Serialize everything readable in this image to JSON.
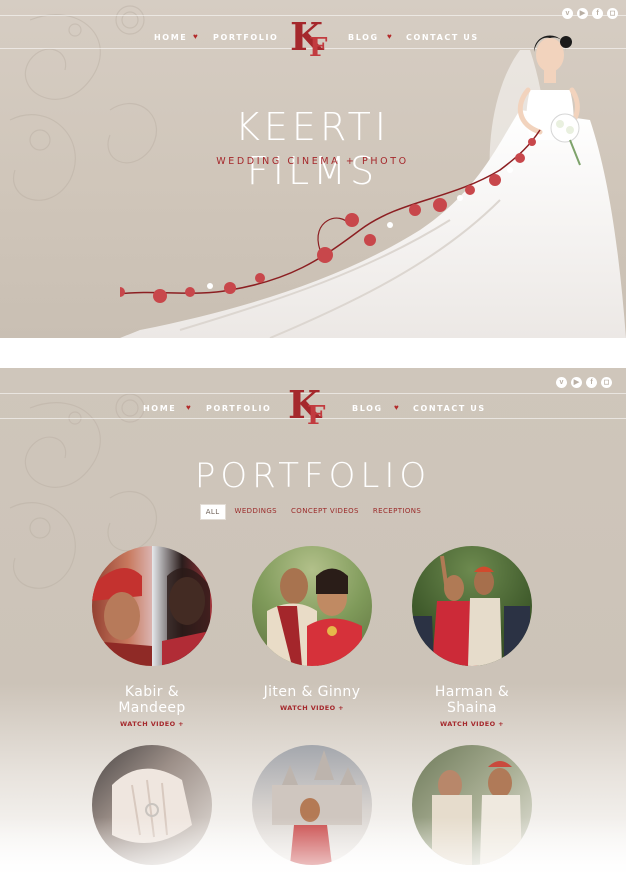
{
  "nav": {
    "home": "HOME",
    "portfolio": "PORTFOLIO",
    "blog": "BLOG",
    "contact": "CONTACT US",
    "logo_text": "K"
  },
  "social": {
    "vimeo": "v",
    "youtube": "▶",
    "facebook": "f",
    "instagram": "◻"
  },
  "hero": {
    "title": "KEERTI FILMS",
    "subtitle": "WEDDING CINEMA + PHOTO"
  },
  "portfolio": {
    "title": "PORTFOLIO",
    "filters": [
      "ALL",
      "WEDDINGS",
      "CONCEPT VIDEOS",
      "RECEPTIONS"
    ],
    "items": [
      {
        "name": "Kabir & Mandeep",
        "cta": "WATCH VIDEO +"
      },
      {
        "name": "Jiten & Ginny",
        "cta": "WATCH VIDEO +"
      },
      {
        "name": "Harman & Shaina",
        "cta": "WATCH VIDEO +"
      }
    ]
  },
  "colors": {
    "accent": "#a5282c",
    "background": "#cfc6bb"
  }
}
